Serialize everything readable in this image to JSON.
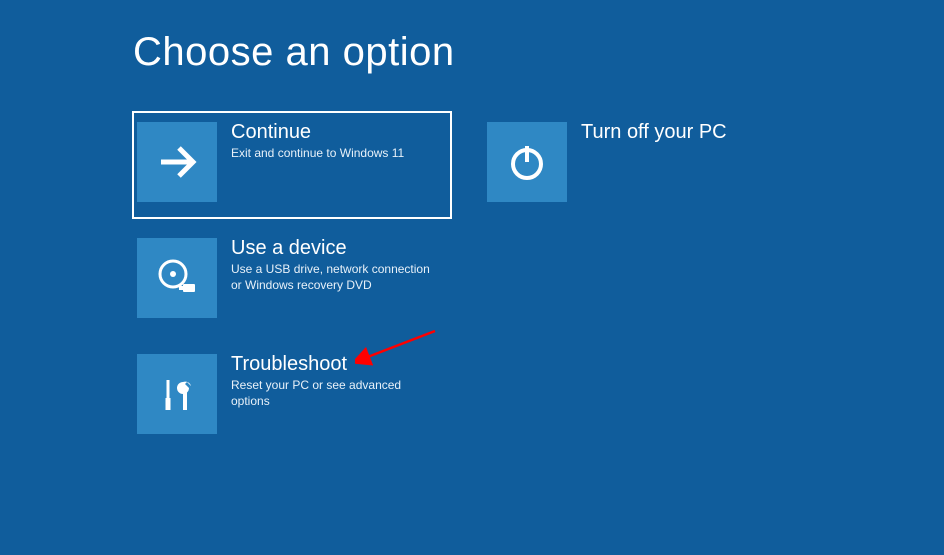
{
  "title": "Choose an option",
  "options": [
    {
      "key": "continue",
      "title": "Continue",
      "desc": "Exit and continue to Windows 11"
    },
    {
      "key": "poweroff",
      "title": "Turn off your PC",
      "desc": ""
    },
    {
      "key": "usedevice",
      "title": "Use a device",
      "desc": "Use a USB drive, network connection or Windows recovery DVD"
    },
    {
      "key": "troubleshoot",
      "title": "Troubleshoot",
      "desc": "Reset your PC or see advanced options"
    }
  ],
  "colors": {
    "background": "#105d9c",
    "tile": "#2f88c4",
    "arrow": "#ff0000"
  }
}
